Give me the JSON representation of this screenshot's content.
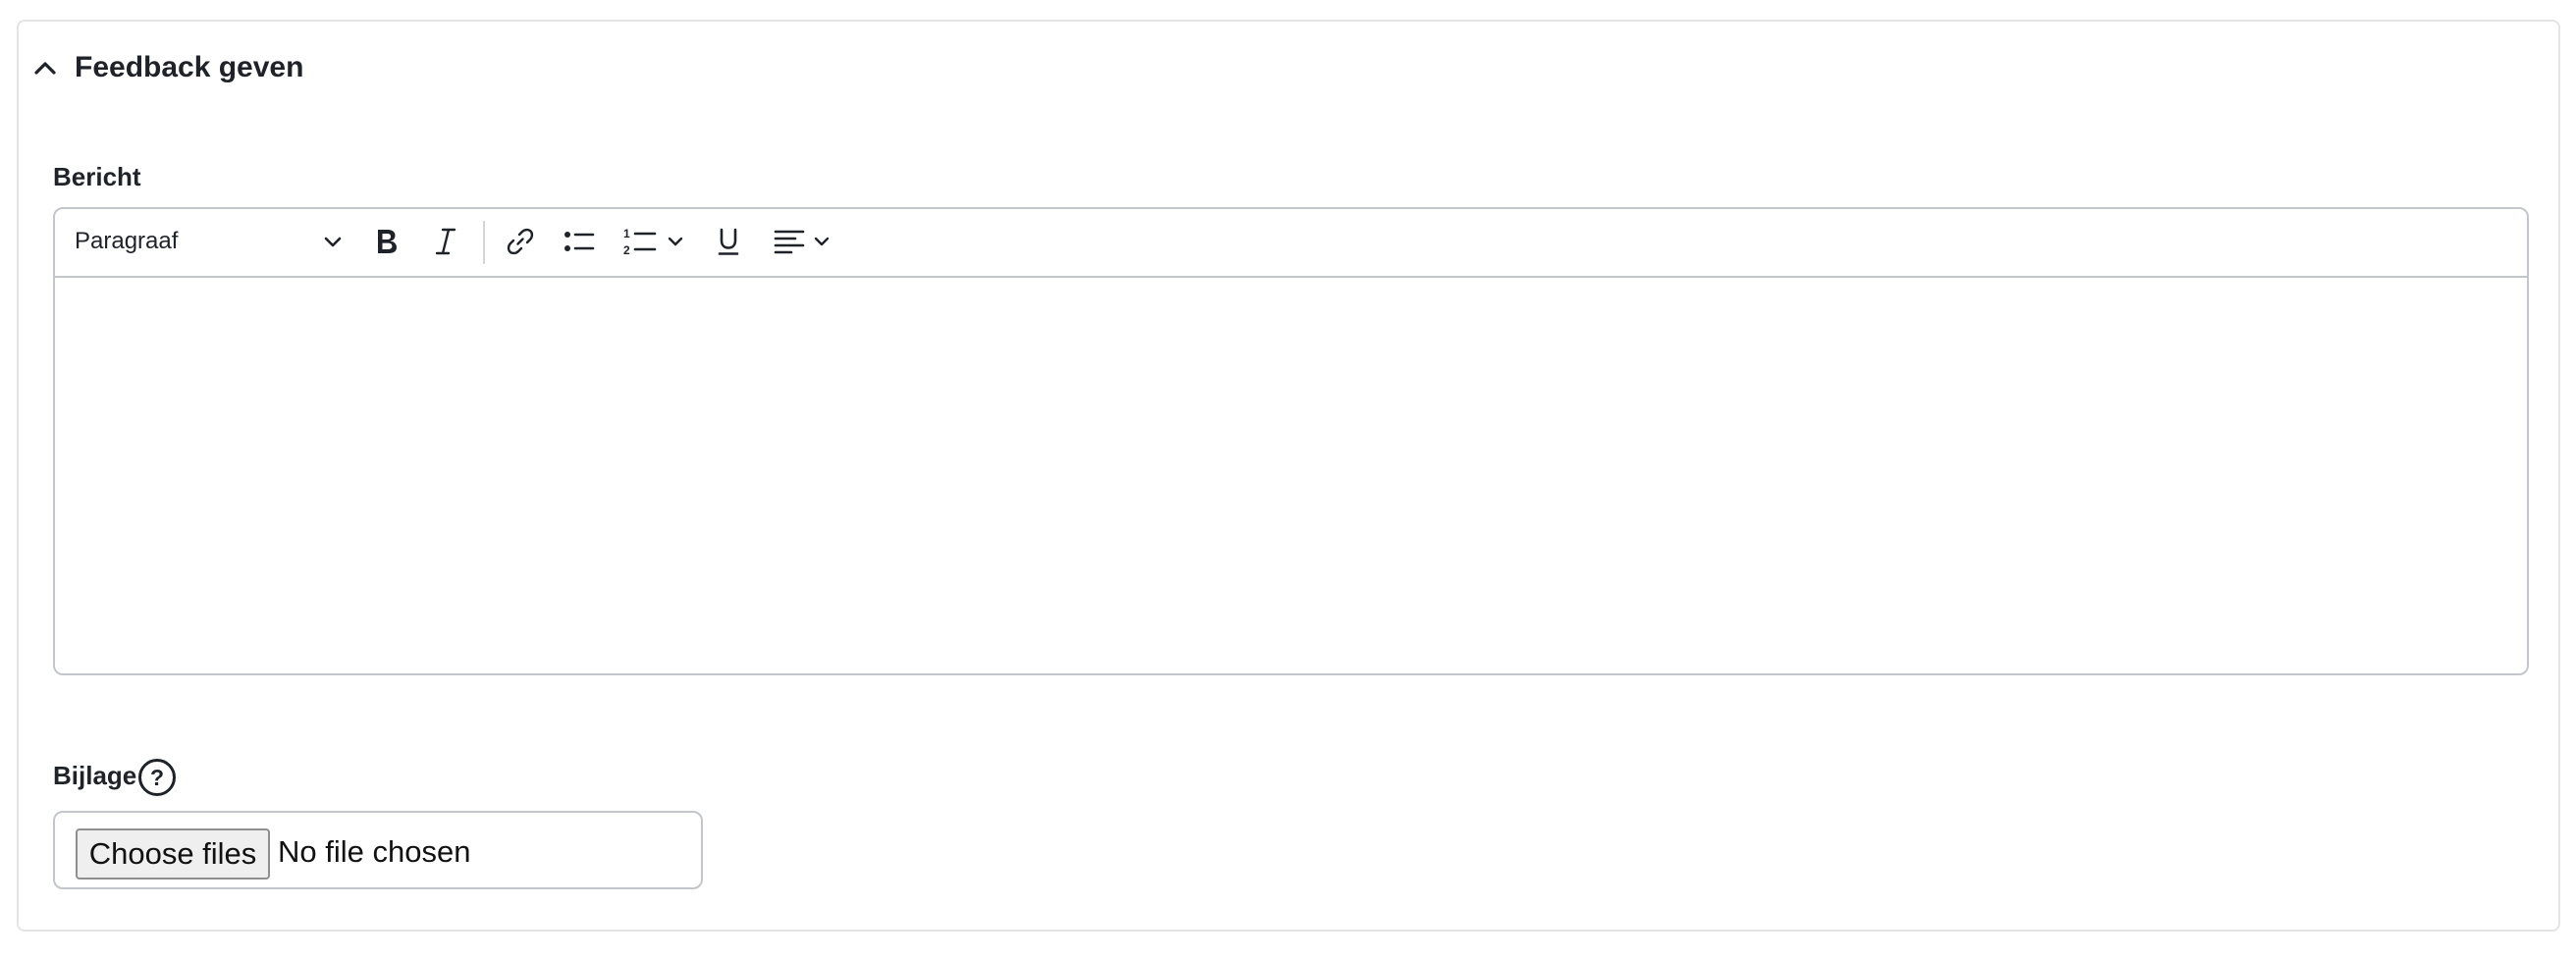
{
  "panel": {
    "title": "Feedback geven",
    "expanded": true
  },
  "message_field": {
    "label": "Bericht",
    "toolbar": {
      "heading_select": "Paragraaf",
      "buttons": [
        "bold",
        "italic",
        "link",
        "bulleted-list",
        "numbered-list",
        "underline",
        "align"
      ]
    },
    "value": ""
  },
  "attachment_field": {
    "label": "Bijlage",
    "help_symbol": "?",
    "choose_button": "Choose files",
    "status": "No file chosen"
  }
}
